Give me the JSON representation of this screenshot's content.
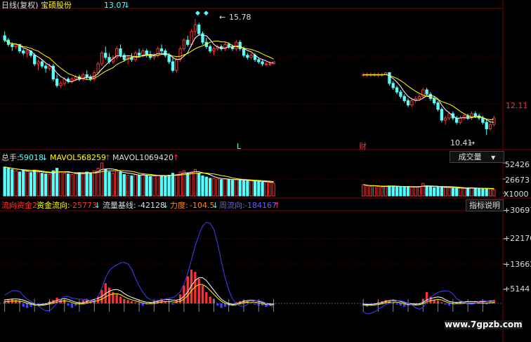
{
  "header": {
    "period": "日线(复权)",
    "stock_name": "宝硕股份",
    "price": "13.07",
    "price_arrow": "↓"
  },
  "price_panel": {
    "high_marker": "15.78",
    "low_marker": "10.41",
    "axis_label": "12.11",
    "event_L": "L",
    "event_cai": "财"
  },
  "volume_panel": {
    "total_label": "总手:",
    "total_value": "59018",
    "total_arrow": "↓",
    "mavol5_label": "MAVOL5:",
    "mavol5_value": "68259",
    "mavol5_arrow": "↑",
    "mavol10_label": "MAVOL10:",
    "mavol10_value": "69420",
    "mavol10_arrow": "↑",
    "selector_label": "成交量",
    "axis_labels": [
      "52426",
      "26673",
      "X1000"
    ]
  },
  "flow_panel": {
    "title_a": "流向资金2",
    "title_b": "资金流向:",
    "flow_value": "-25773",
    "flow_arrow": "↓",
    "base_label": "流量基线:",
    "base_value": "-42128",
    "base_arrow": "↓",
    "force_label": "力度:",
    "force_value": "-104.5",
    "force_arrow": "↓",
    "week_label": "周流向:",
    "week_value": "-184167",
    "week_arrow": "↑",
    "help_label": "指标说明",
    "axis_labels": [
      "+30697",
      "+22170",
      "+13662",
      "+5144"
    ]
  },
  "watermark": "www.7gpzb.com",
  "colors": {
    "up": "#ff3232",
    "down": "#54ffff",
    "grid": "#7a0000",
    "ma_white": "#ffffff",
    "ma_yellow": "#ffff00",
    "week_line": "#4040ff"
  },
  "chart_data": {
    "type": "candlestick",
    "candles": [
      [
        15.0,
        15.2,
        14.7,
        14.8
      ],
      [
        14.8,
        14.9,
        14.5,
        14.6
      ],
      [
        14.6,
        14.7,
        14.3,
        14.5
      ],
      [
        14.5,
        14.6,
        14.4,
        14.6
      ],
      [
        14.6,
        14.6,
        14.2,
        14.3
      ],
      [
        14.3,
        14.4,
        14.1,
        14.2
      ],
      [
        14.2,
        14.4,
        14.0,
        14.3
      ],
      [
        14.3,
        14.3,
        14.0,
        14.1
      ],
      [
        14.1,
        14.2,
        13.6,
        13.7
      ],
      [
        13.7,
        13.9,
        13.4,
        13.8
      ],
      [
        13.8,
        13.9,
        13.5,
        13.6
      ],
      [
        13.6,
        13.7,
        13.3,
        13.5
      ],
      [
        13.5,
        13.7,
        13.4,
        13.6
      ],
      [
        13.6,
        13.7,
        12.9,
        13.0
      ],
      [
        13.0,
        13.2,
        12.6,
        12.7
      ],
      [
        12.7,
        12.9,
        12.6,
        12.8
      ],
      [
        12.8,
        13.1,
        12.7,
        13.0
      ],
      [
        13.0,
        13.1,
        12.8,
        12.9
      ],
      [
        12.9,
        13.1,
        12.8,
        13.0
      ],
      [
        13.0,
        13.2,
        12.9,
        13.1
      ],
      [
        13.1,
        13.2,
        12.9,
        13.0
      ],
      [
        13.0,
        13.3,
        12.9,
        13.2
      ],
      [
        13.2,
        13.4,
        13.0,
        13.1
      ],
      [
        13.1,
        13.2,
        12.9,
        13.0
      ],
      [
        13.0,
        13.4,
        12.9,
        13.3
      ],
      [
        13.3,
        13.8,
        13.2,
        13.7
      ],
      [
        13.7,
        14.3,
        13.6,
        14.2
      ],
      [
        14.2,
        14.5,
        13.9,
        14.0
      ],
      [
        14.0,
        14.2,
        13.7,
        13.8
      ],
      [
        13.8,
        14.1,
        13.7,
        14.0
      ],
      [
        14.0,
        14.5,
        13.9,
        14.4
      ],
      [
        14.4,
        14.6,
        14.0,
        14.1
      ],
      [
        14.1,
        14.2,
        13.8,
        13.9
      ],
      [
        13.9,
        14.1,
        13.7,
        14.0
      ],
      [
        14.0,
        14.2,
        13.8,
        13.9
      ],
      [
        13.9,
        14.3,
        13.8,
        14.2
      ],
      [
        14.2,
        14.4,
        14.0,
        14.1
      ],
      [
        14.1,
        14.4,
        14.0,
        14.3
      ],
      [
        14.3,
        14.4,
        14.0,
        14.1
      ],
      [
        14.1,
        14.3,
        13.9,
        14.0
      ],
      [
        14.0,
        14.2,
        13.9,
        14.1
      ],
      [
        14.1,
        14.5,
        14.0,
        14.4
      ],
      [
        14.4,
        14.6,
        14.2,
        14.3
      ],
      [
        14.3,
        14.4,
        14.0,
        14.1
      ],
      [
        14.1,
        14.2,
        13.7,
        13.8
      ],
      [
        13.8,
        14.0,
        13.3,
        13.4
      ],
      [
        13.4,
        14.0,
        13.3,
        13.9
      ],
      [
        13.9,
        14.5,
        13.8,
        14.4
      ],
      [
        14.4,
        14.9,
        14.3,
        14.8
      ],
      [
        14.8,
        15.0,
        14.5,
        14.6
      ],
      [
        14.6,
        15.3,
        14.5,
        15.2
      ],
      [
        15.2,
        15.78,
        15.0,
        15.5
      ],
      [
        15.5,
        15.6,
        15.0,
        15.1
      ],
      [
        15.1,
        15.2,
        14.6,
        14.7
      ],
      [
        14.7,
        14.9,
        14.4,
        14.5
      ],
      [
        14.5,
        14.6,
        14.2,
        14.3
      ],
      [
        14.3,
        14.5,
        14.1,
        14.4
      ],
      [
        14.4,
        14.6,
        14.3,
        14.5
      ],
      [
        14.5,
        14.6,
        14.3,
        14.4
      ],
      [
        14.4,
        14.7,
        14.3,
        14.6
      ],
      [
        14.6,
        14.7,
        14.4,
        14.5
      ],
      [
        14.5,
        14.6,
        14.3,
        14.4
      ],
      [
        14.4,
        14.8,
        14.3,
        14.7
      ],
      [
        14.7,
        14.8,
        14.3,
        14.4
      ],
      [
        14.4,
        14.5,
        14.0,
        14.1
      ],
      [
        14.1,
        14.2,
        13.9,
        14.0
      ],
      [
        14.0,
        14.2,
        13.9,
        14.1
      ],
      [
        14.1,
        14.2,
        13.8,
        13.9
      ],
      [
        13.9,
        14.0,
        13.7,
        13.8
      ],
      [
        13.8,
        13.9,
        13.6,
        13.7
      ],
      [
        13.7,
        13.8,
        13.6,
        13.7
      ],
      [
        13.7,
        13.8,
        13.6,
        13.7
      ],
      [
        13.7,
        13.8,
        13.7,
        13.8
      ],
      null,
      null,
      null,
      null,
      null,
      null,
      null,
      null,
      null,
      null,
      null,
      null,
      null,
      null,
      null,
      null,
      null,
      null,
      null,
      null,
      null,
      null,
      null,
      [
        13.2,
        13.3,
        13.1,
        13.2
      ],
      [
        13.2,
        13.3,
        13.1,
        13.2
      ],
      [
        13.2,
        13.3,
        13.1,
        13.2
      ],
      [
        13.2,
        13.3,
        13.1,
        13.2
      ],
      [
        13.2,
        13.3,
        13.1,
        13.2
      ],
      [
        13.2,
        13.3,
        13.1,
        13.2
      ],
      [
        13.2,
        13.3,
        13.2,
        13.3
      ],
      [
        13.3,
        13.3,
        12.7,
        12.8
      ],
      [
        12.8,
        12.9,
        12.5,
        12.6
      ],
      [
        12.6,
        12.7,
        12.3,
        12.4
      ],
      [
        12.4,
        12.5,
        12.1,
        12.2
      ],
      [
        12.2,
        12.3,
        11.9,
        12.0
      ],
      [
        12.0,
        12.1,
        11.7,
        11.8
      ],
      [
        11.8,
        12.1,
        11.7,
        12.0
      ],
      [
        12.0,
        12.2,
        11.9,
        12.1
      ],
      [
        12.1,
        12.3,
        12.0,
        12.2
      ],
      [
        12.2,
        12.6,
        12.1,
        12.5
      ],
      [
        12.5,
        12.6,
        12.2,
        12.3
      ],
      [
        12.3,
        12.4,
        12.0,
        12.1
      ],
      [
        12.1,
        12.2,
        11.8,
        11.9
      ],
      [
        11.9,
        12.0,
        11.5,
        11.6
      ],
      [
        11.6,
        11.7,
        11.0,
        11.1
      ],
      [
        11.1,
        11.3,
        10.9,
        11.2
      ],
      [
        11.2,
        11.5,
        11.1,
        11.4
      ],
      [
        11.4,
        11.5,
        11.1,
        11.2
      ],
      [
        11.2,
        11.3,
        10.9,
        11.0
      ],
      [
        11.0,
        11.3,
        10.9,
        11.2
      ],
      [
        11.2,
        11.4,
        11.1,
        11.3
      ],
      [
        11.3,
        11.4,
        11.1,
        11.2
      ],
      [
        11.2,
        11.5,
        11.1,
        11.4
      ],
      [
        11.4,
        11.5,
        11.2,
        11.3
      ],
      [
        11.3,
        11.4,
        11.1,
        11.2
      ],
      [
        11.2,
        11.3,
        10.9,
        11.0
      ],
      [
        11.0,
        11.1,
        10.41,
        10.7
      ],
      [
        10.7,
        11.0,
        10.6,
        10.9
      ],
      [
        10.9,
        11.3,
        10.8,
        11.2
      ]
    ],
    "volume": [
      46000,
      44000,
      42000,
      40000,
      38000,
      40000,
      39000,
      37000,
      41000,
      38000,
      36000,
      35000,
      34000,
      40000,
      44000,
      38000,
      36000,
      35000,
      34000,
      36000,
      37000,
      35000,
      38000,
      36000,
      40000,
      44000,
      52426,
      42000,
      38000,
      36000,
      40000,
      38000,
      34000,
      33000,
      32000,
      34000,
      33000,
      34000,
      32000,
      31000,
      32000,
      33000,
      32000,
      31000,
      33000,
      36000,
      34000,
      38000,
      40000,
      36000,
      38000,
      42000,
      36000,
      32000,
      30000,
      28000,
      28000,
      27000,
      26000,
      27000,
      26000,
      25000,
      26000,
      25000,
      24000,
      24000,
      24000,
      23000,
      23000,
      22000,
      22000,
      21000,
      20000,
      null,
      null,
      null,
      null,
      null,
      null,
      null,
      null,
      null,
      null,
      null,
      null,
      null,
      null,
      null,
      null,
      null,
      null,
      null,
      null,
      null,
      null,
      null,
      18000,
      16000,
      15000,
      16000,
      15000,
      14000,
      15000,
      16000,
      16000,
      15000,
      14000,
      14000,
      15000,
      14000,
      14000,
      15000,
      20000,
      16000,
      14000,
      13000,
      14000,
      15000,
      13000,
      13000,
      12000,
      12000,
      13000,
      12000,
      12000,
      13000,
      12000,
      12000,
      11000,
      12000,
      11000,
      10000
    ],
    "flow_axis_ticks": [
      30697,
      22170,
      13662,
      5144
    ]
  }
}
